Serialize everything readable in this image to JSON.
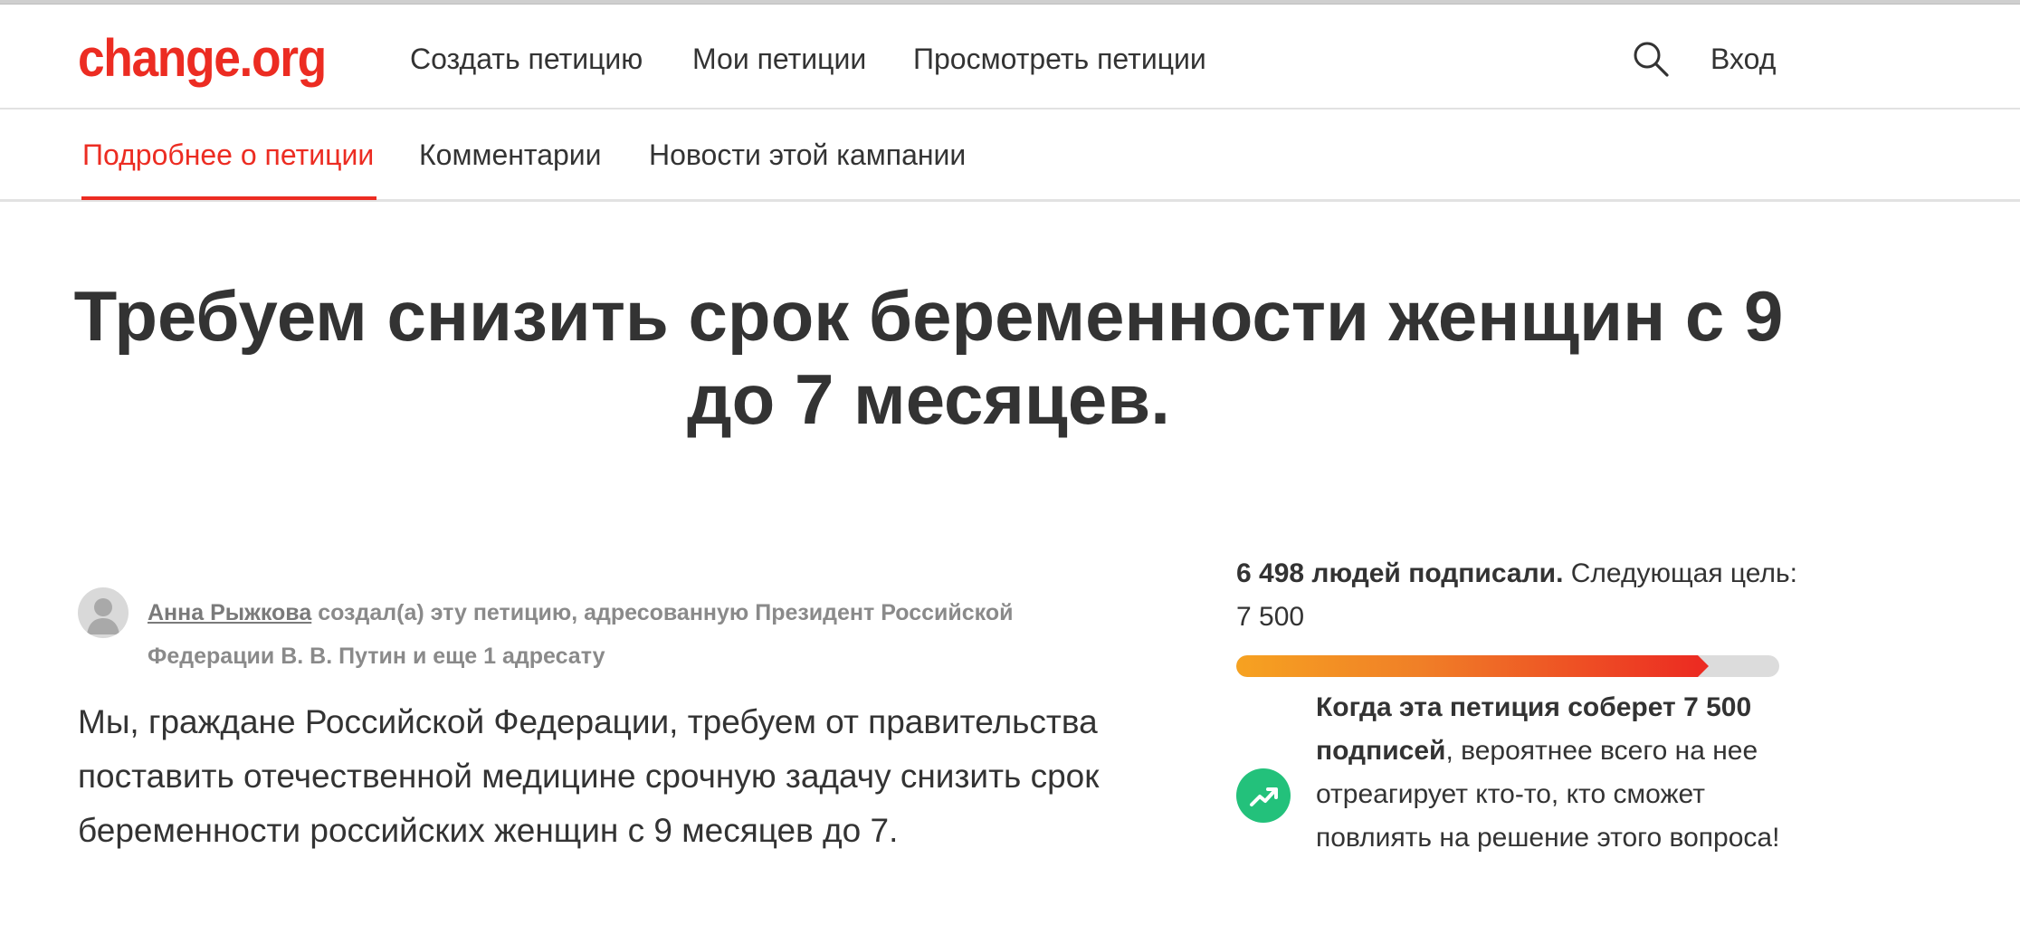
{
  "header": {
    "logo": "change.org",
    "nav": {
      "create": "Создать петицию",
      "my": "Мои петиции",
      "browse": "Просмотреть петиции"
    },
    "search_icon": "search-icon",
    "login": "Вход"
  },
  "tabs": {
    "details": "Подробнее о петиции",
    "comments": "Комментарии",
    "updates": "Новости этой кампании"
  },
  "petition": {
    "title": "Требуем снизить срок беременности женщин с 9 до 7 месяцев.",
    "author": "Анна Рыжкова",
    "created_text": "создал(а) эту петицию, адресованную Президент Российской Федерации В. В. Путин и  еще 1 адресату",
    "body": "Мы, граждане Российской Федерации, требуем от правительства поставить отечественной медицине срочную задачу снизить срок беременности российских женщин с 9 месяцев до 7."
  },
  "signatures": {
    "count_text": "6 498 людей подписали.",
    "next_goal_text": " Следующая цель: 7 500",
    "progress_fraction": 0.87,
    "goal_bold": "Когда эта петиция соберет 7 500 подписей",
    "goal_rest": ", вероятнее всего на нее отреагирует кто-то, кто сможет повлиять на решение этого вопроса!",
    "trend_icon": "trending-up-icon"
  },
  "colors": {
    "brand": "#ec2c22",
    "progress_start": "#f6a221",
    "progress_end": "#ec2c22",
    "success": "#23c17b"
  }
}
